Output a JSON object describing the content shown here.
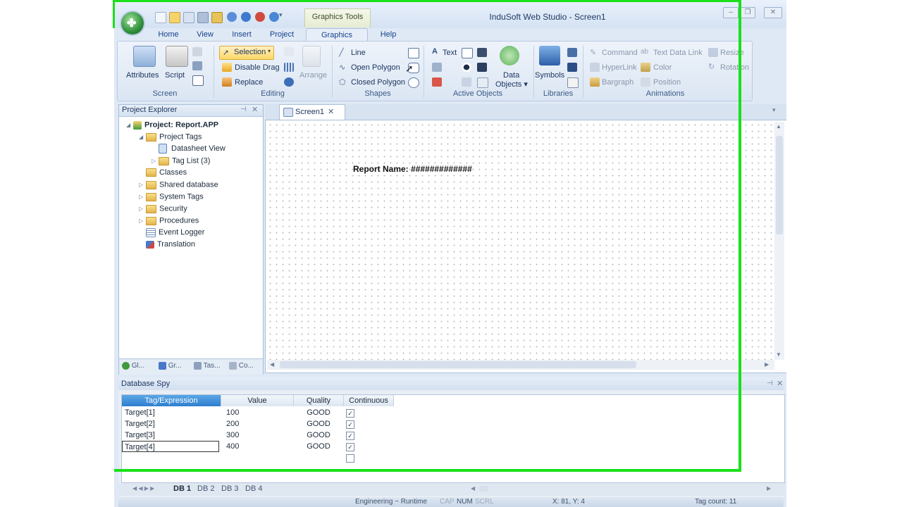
{
  "window": {
    "title": "InduSoft Web Studio - Screen1",
    "context_tab": "Graphics Tools",
    "buttons": [
      "–",
      "❐",
      "✕"
    ]
  },
  "menu_tabs": [
    "Home",
    "View",
    "Insert",
    "Project",
    "Graphics",
    "Help"
  ],
  "ribbon": {
    "screen": {
      "label": "Screen",
      "attributes": "Attributes",
      "script": "Script"
    },
    "editing": {
      "label": "Editing",
      "selection": "Selection",
      "disable_drag": "Disable Drag",
      "replace": "Replace",
      "arrange": "Arrange"
    },
    "shapes": {
      "label": "Shapes",
      "line": "Line",
      "open_polygon": "Open Polygon",
      "closed_polygon": "Closed Polygon"
    },
    "active_objects": {
      "label": "Active Objects",
      "text": "Text",
      "data_objects_1": "Data",
      "data_objects_2": "Objects ▾"
    },
    "libraries": {
      "label": "Libraries",
      "symbols": "Symbols"
    },
    "animations": {
      "label": "Animations",
      "command": "Command",
      "text_data_link": "Text Data Link",
      "resize": "Resize",
      "hyperlink": "HyperLink",
      "color": "Color",
      "rotation": "Rotation",
      "bargraph": "Bargraph",
      "position": "Position"
    }
  },
  "explorer": {
    "title": "Project Explorer",
    "items": [
      {
        "label": "Project: Report.APP",
        "bold": true
      },
      {
        "label": "Project Tags"
      },
      {
        "label": "Datasheet View"
      },
      {
        "label": "Tag List (3)"
      },
      {
        "label": "Classes"
      },
      {
        "label": "Shared database"
      },
      {
        "label": "System Tags"
      },
      {
        "label": "Security"
      },
      {
        "label": "Procedures"
      },
      {
        "label": "Event Logger"
      },
      {
        "label": "Translation"
      }
    ],
    "tabs": [
      "Gl...",
      "Gr...",
      "Tas...",
      "Co..."
    ]
  },
  "document": {
    "tab": "Screen1",
    "report_text": "Report Name: #############"
  },
  "database_spy": {
    "title": "Database Spy",
    "columns": [
      "Tag/Expression",
      "Value",
      "Quality",
      "Continuous"
    ],
    "rows": [
      {
        "tag": "Target[1]",
        "value": "100",
        "quality": "GOOD",
        "continuous": true
      },
      {
        "tag": "Target[2]",
        "value": "200",
        "quality": "GOOD",
        "continuous": true
      },
      {
        "tag": "Target[3]",
        "value": "300",
        "quality": "GOOD",
        "continuous": true
      },
      {
        "tag": "Target[4]",
        "value": "400",
        "quality": "GOOD",
        "continuous": true
      }
    ],
    "sheet_tabs": [
      "DB 1",
      "DB 2",
      "DB 3",
      "DB 4"
    ]
  },
  "status": {
    "mode": "Engineering ~ Runtime",
    "cap": "CAP",
    "num": "NUM",
    "scrl": "SCRL",
    "coords": "X: 81, Y: 4",
    "tag_count": "Tag count: 11"
  },
  "colors": {
    "highlight_green": "#19e019",
    "ribbon_blue": "#dbe6f3",
    "title_text": "#1f3b63"
  }
}
